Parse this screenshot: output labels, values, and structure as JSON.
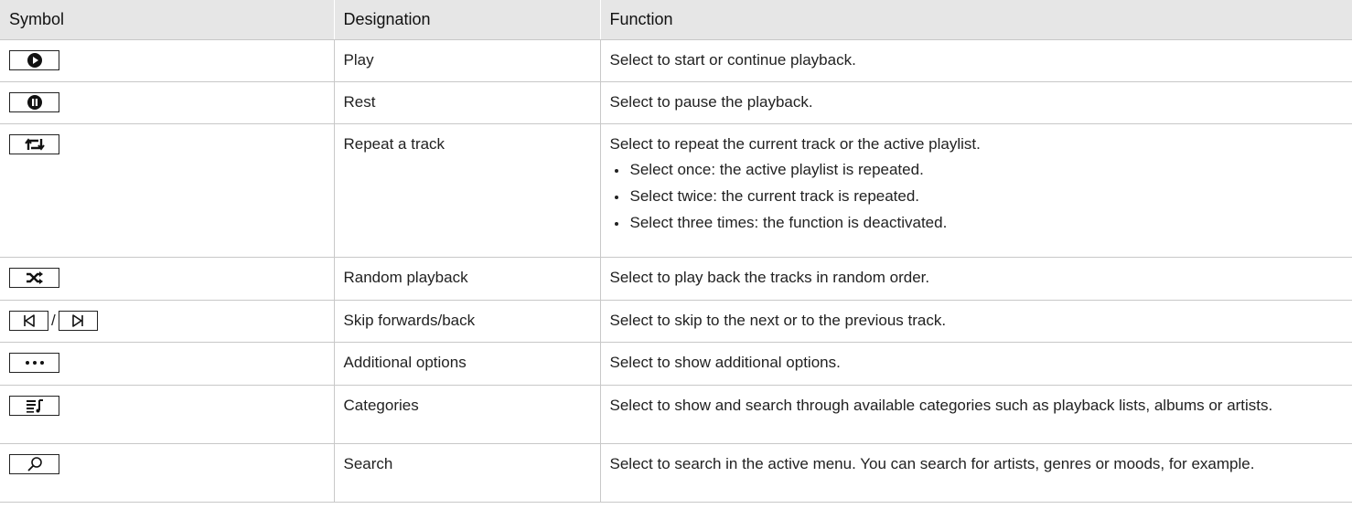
{
  "header": {
    "col1": "Symbol",
    "col2": "Designation",
    "col3": "Function"
  },
  "rows": [
    {
      "icon": "play-icon",
      "designation": "Play",
      "function": "Select to start or continue playback."
    },
    {
      "icon": "pause-icon",
      "designation": "Rest",
      "function": "Select to pause the playback."
    },
    {
      "icon": "repeat-icon",
      "designation": "Repeat a track",
      "function": "Select to repeat the current track or the active playlist.",
      "bullets": [
        "Select once: the active playlist is repeated.",
        "Select twice: the current track is repeated.",
        "Select three times: the function is deactivated."
      ]
    },
    {
      "icon": "shuffle-icon",
      "designation": "Random playback",
      "function": "Select to play back the tracks in random order."
    },
    {
      "icon": "skip-back-icon / skip-forward-icon",
      "separator": "/",
      "designation": "Skip forwards/back",
      "function": "Select to skip to the next or to the previous track."
    },
    {
      "icon": "more-options-icon",
      "designation": "Additional options",
      "function": "Select to show additional options."
    },
    {
      "icon": "categories-icon",
      "designation": "Categories",
      "function": "Select to show and search through available categories such as playback lists, albums or artists."
    },
    {
      "icon": "search-icon",
      "designation": "Search",
      "function": "Select to search in the active menu. You can search for artists, genres or moods, for example."
    }
  ]
}
